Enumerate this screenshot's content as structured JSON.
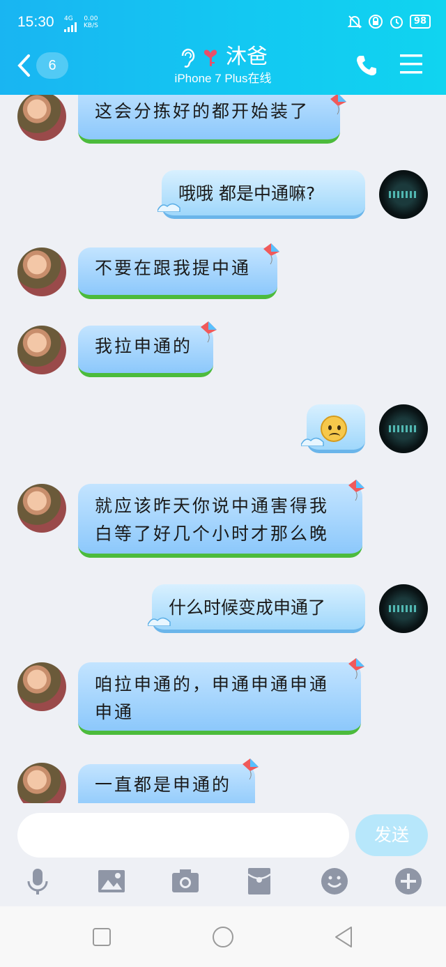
{
  "status_bar": {
    "time": "15:30",
    "network": "4G",
    "speed_value": "0.00",
    "speed_unit": "KB/S",
    "battery": "98"
  },
  "header": {
    "unread_count": "6",
    "contact_name": "沐爸",
    "subtitle": "iPhone 7 Plus在线"
  },
  "messages": [
    {
      "side": "left",
      "text": "这会分拣好的都开始装了"
    },
    {
      "side": "right",
      "text": "哦哦  都是中通嘛?"
    },
    {
      "side": "left",
      "text": "不要在跟我提中通"
    },
    {
      "side": "left",
      "text": "我拉申通的"
    },
    {
      "side": "right",
      "text": "",
      "emoji": "sad-face"
    },
    {
      "side": "left",
      "line1": "就应该昨天你说中通害得我",
      "line2": "白等了好几个小时才那么晚"
    },
    {
      "side": "right",
      "text": "什么时候变成申通了"
    },
    {
      "side": "left",
      "line1": "咱拉申通的，申通申通申通",
      "line2": "申通"
    },
    {
      "side": "left",
      "text": "一直都是申通的"
    }
  ],
  "composer": {
    "input_value": "",
    "send_label": "发送"
  },
  "colors": {
    "header_start": "#19b5f2",
    "header_end": "#10d4f0",
    "send_button": "#b7e7fb",
    "grass": "#4cbb3c"
  }
}
